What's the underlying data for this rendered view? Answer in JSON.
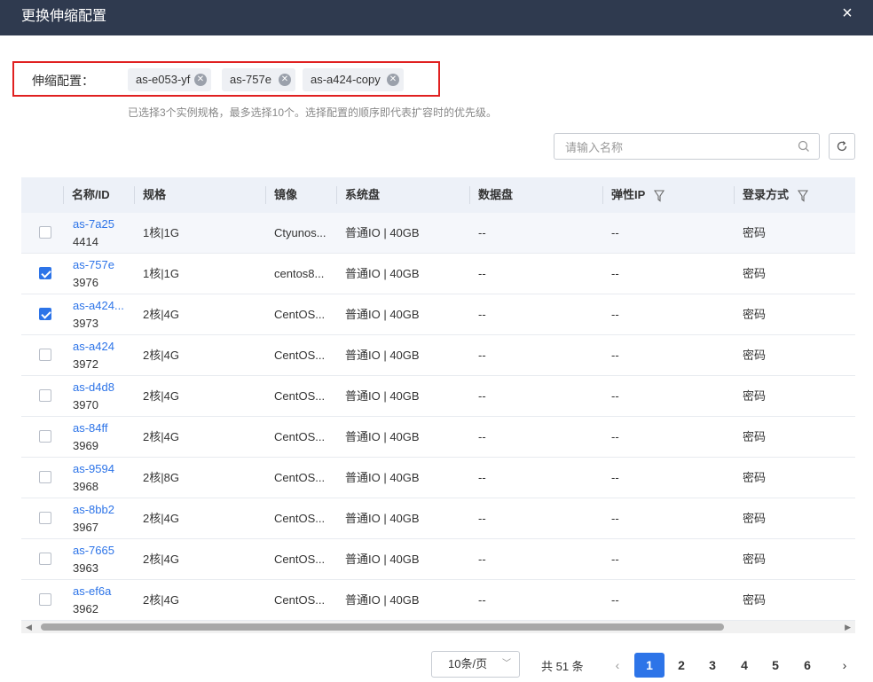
{
  "dialog": {
    "title": "更换伸缩配置",
    "close_icon": "×"
  },
  "config": {
    "label": "伸缩配置：",
    "tags": [
      "as-e053-yf",
      "as-757e",
      "as-a424-copy"
    ],
    "hint": "已选择3个实例规格，最多选择10个。选择配置的顺序即代表扩容时的优先级。"
  },
  "search": {
    "placeholder": "请输入名称",
    "value": ""
  },
  "table": {
    "headers": {
      "name": "名称/ID",
      "spec": "规格",
      "image": "镜像",
      "sysdisk": "系统盘",
      "datadisk": "数据盘",
      "eip": "弹性IP",
      "login": "登录方式"
    },
    "rows": [
      {
        "checked": false,
        "name": "as-7a25",
        "id": "4414",
        "spec": "1核|1G",
        "image": "Ctyunos...",
        "sysdisk": "普通IO | 40GB",
        "datadisk": "--",
        "eip": "--",
        "login": "密码"
      },
      {
        "checked": true,
        "name": "as-757e",
        "id": "3976",
        "spec": "1核|1G",
        "image": "centos8...",
        "sysdisk": "普通IO | 40GB",
        "datadisk": "--",
        "eip": "--",
        "login": "密码"
      },
      {
        "checked": true,
        "name": "as-a424...",
        "id": "3973",
        "spec": "2核|4G",
        "image": "CentOS...",
        "sysdisk": "普通IO | 40GB",
        "datadisk": "--",
        "eip": "--",
        "login": "密码"
      },
      {
        "checked": false,
        "name": "as-a424",
        "id": "3972",
        "spec": "2核|4G",
        "image": "CentOS...",
        "sysdisk": "普通IO | 40GB",
        "datadisk": "--",
        "eip": "--",
        "login": "密码"
      },
      {
        "checked": false,
        "name": "as-d4d8",
        "id": "3970",
        "spec": "2核|4G",
        "image": "CentOS...",
        "sysdisk": "普通IO | 40GB",
        "datadisk": "--",
        "eip": "--",
        "login": "密码"
      },
      {
        "checked": false,
        "name": "as-84ff",
        "id": "3969",
        "spec": "2核|4G",
        "image": "CentOS...",
        "sysdisk": "普通IO | 40GB",
        "datadisk": "--",
        "eip": "--",
        "login": "密码"
      },
      {
        "checked": false,
        "name": "as-9594",
        "id": "3968",
        "spec": "2核|8G",
        "image": "CentOS...",
        "sysdisk": "普通IO | 40GB",
        "datadisk": "--",
        "eip": "--",
        "login": "密码"
      },
      {
        "checked": false,
        "name": "as-8bb2",
        "id": "3967",
        "spec": "2核|4G",
        "image": "CentOS...",
        "sysdisk": "普通IO | 40GB",
        "datadisk": "--",
        "eip": "--",
        "login": "密码"
      },
      {
        "checked": false,
        "name": "as-7665",
        "id": "3963",
        "spec": "2核|4G",
        "image": "CentOS...",
        "sysdisk": "普通IO | 40GB",
        "datadisk": "--",
        "eip": "--",
        "login": "密码"
      },
      {
        "checked": false,
        "name": "as-ef6a",
        "id": "3962",
        "spec": "2核|4G",
        "image": "CentOS...",
        "sysdisk": "普通IO | 40GB",
        "datadisk": "--",
        "eip": "--",
        "login": "密码"
      }
    ]
  },
  "pagination": {
    "page_size": "10条/页",
    "total": "共 51 条",
    "pages": [
      "1",
      "2",
      "3",
      "4",
      "5",
      "6"
    ],
    "current": "1",
    "prev_icon": "‹",
    "next_icon": "›"
  },
  "colors": {
    "header_bg": "#2f3a4f",
    "accent": "#2d74e8",
    "highlight_border": "#e02020"
  }
}
